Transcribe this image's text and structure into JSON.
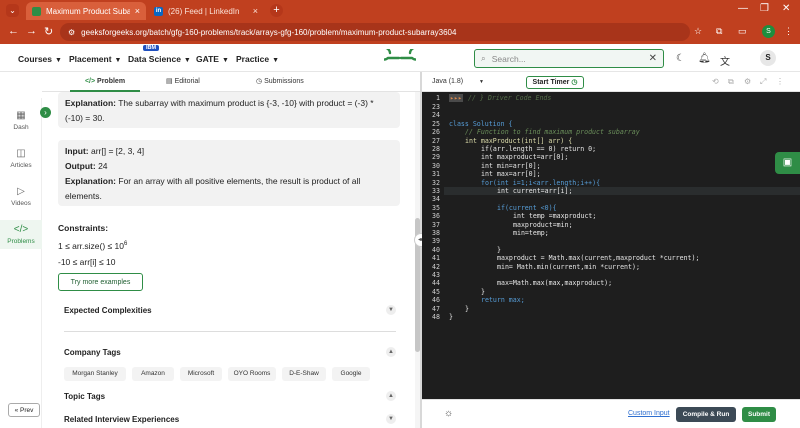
{
  "browser": {
    "tabs": [
      {
        "title": "Maximum Product Subarray |",
        "active": true
      },
      {
        "title": "(26) Feed | LinkedIn",
        "active": false
      }
    ],
    "url": "geeksforgeeks.org/batch/gfg-160-problems/track/arrays-gfg-160/problem/maximum-product-subarray3604",
    "profile_initial": "S"
  },
  "site": {
    "nav": [
      {
        "label": "Courses"
      },
      {
        "label": "Placement"
      },
      {
        "label": "Data Science",
        "badge": "IBM"
      },
      {
        "label": "GATE"
      },
      {
        "label": "Practice"
      }
    ],
    "logo_text": "GG",
    "search_placeholder": "Search...",
    "avatar_initial": "S",
    "brand_color": "#2f8d46"
  },
  "rail": {
    "items": [
      {
        "label": "Dash",
        "icon": "dashboard-icon"
      },
      {
        "label": "Articles",
        "icon": "book-icon"
      },
      {
        "label": "Videos",
        "icon": "video-icon"
      },
      {
        "label": "Problems",
        "icon": "code-icon",
        "selected": true
      }
    ],
    "prev_label": "« Prev"
  },
  "problem_tabs": [
    {
      "label": "Problem",
      "icon": "</>"
    },
    {
      "label": "Editorial",
      "icon": "doc-icon"
    },
    {
      "label": "Submissions",
      "icon": "clock-icon"
    }
  ],
  "problem": {
    "example2": {
      "explanation_label": "Explanation:",
      "explanation_text": "The subarray with maximum product is {-3, -10} with product = (-3) * (-10) = 30."
    },
    "example3": {
      "input_label": "Input:",
      "input_text": "arr[] = [2, 3, 4]",
      "output_label": "Output:",
      "output_text": "24",
      "explanation_label": "Explanation:",
      "explanation_text": "For an array with all positive elements, the result is product of all elements."
    },
    "constraints_title": "Constraints:",
    "constraint1_prefix": "1 ≤ arr.size() ≤ 10",
    "constraint1_exp": "6",
    "constraint2": "-10  ≤  arr[i]  ≤  10",
    "try_more": "Try more examples",
    "sections": {
      "complexities": "Expected Complexities",
      "company_tags": "Company Tags",
      "topic_tags": "Topic Tags",
      "interview": "Related Interview Experiences"
    },
    "company_tags": [
      "Morgan Stanley",
      "Amazon",
      "Microsoft",
      "OYO Rooms",
      "D-E-Shaw",
      "Google"
    ]
  },
  "editor": {
    "language": "Java (1.8)",
    "timer_label": "Start Timer",
    "first_line": 1,
    "line_numbers": [
      "23",
      "24",
      "25",
      "26",
      "27",
      "28",
      "29",
      "30",
      "31",
      "32",
      "33",
      "34",
      "35",
      "36",
      "37",
      "38",
      "39",
      "40",
      "41",
      "42",
      "43",
      "44",
      "45",
      "46",
      "47",
      "48"
    ],
    "collapsed_line": "// } Driver Code Ends",
    "code": {
      "l25": "class Solution {",
      "l26": "// Function to find maximum product subarray",
      "l27": "int maxProduct(int[] arr) {",
      "l28": "if(arr.length == 0) return 0;",
      "l29": "int maxproduct=arr[0];",
      "l30": "int min=arr[0];",
      "l31": "int max=arr[0];",
      "l32": "for(int i=1;i<arr.length;i++){",
      "l33": "int current=arr[i];",
      "l35": "if(current <0){",
      "l36": "int temp =maxproduct;",
      "l37": "maxproduct=min;",
      "l38": "min=temp;",
      "l40": "}",
      "l41": "maxproduct = Math.max(current,maxproduct *current);",
      "l42": "min= Math.min(current,min *current);",
      "l44": "max=Math.max(max,maxproduct);",
      "l45": "}",
      "l46": "return max;",
      "l47": "}",
      "l48": "}"
    },
    "custom_input": "Custom Input",
    "compile_label": "Compile & Run",
    "submit_label": "Submit"
  }
}
